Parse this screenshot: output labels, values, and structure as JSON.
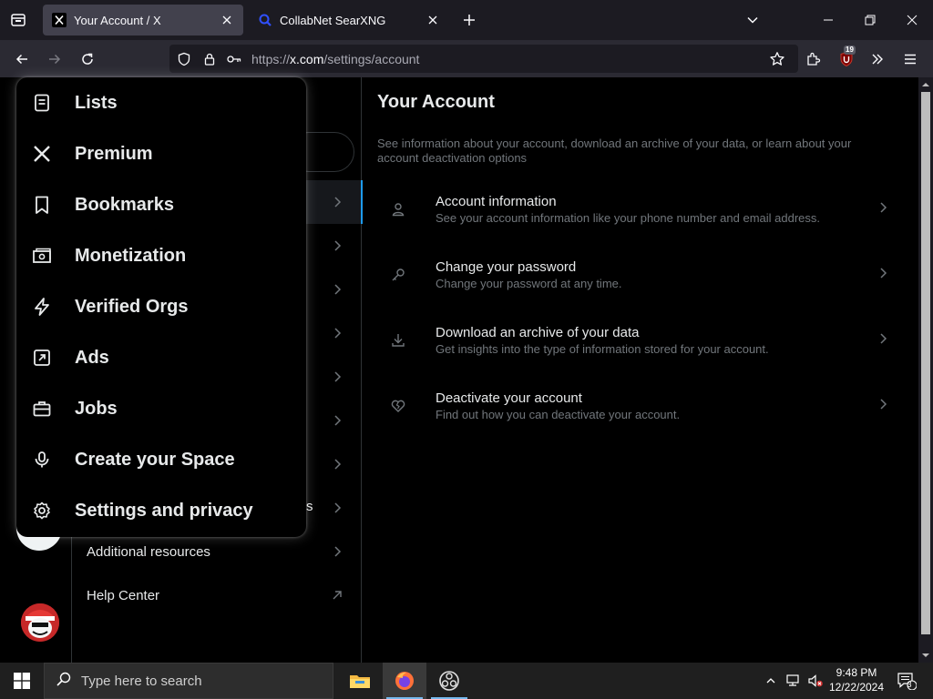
{
  "browser": {
    "tabs": [
      {
        "title": "Your Account / X",
        "active": true
      },
      {
        "title": "CollabNet SearXNG",
        "active": false
      }
    ],
    "url": {
      "prefix": "https://",
      "host": "x.com",
      "path": "/settings/account"
    },
    "extension_badge": "19"
  },
  "more_menu": {
    "items": [
      {
        "label": "Lists",
        "icon": "list-icon"
      },
      {
        "label": "Premium",
        "icon": "x-logo-icon"
      },
      {
        "label": "Bookmarks",
        "icon": "bookmark-icon"
      },
      {
        "label": "Monetization",
        "icon": "money-icon"
      },
      {
        "label": "Verified Orgs",
        "icon": "lightning-icon"
      },
      {
        "label": "Ads",
        "icon": "external-arrow-icon"
      },
      {
        "label": "Jobs",
        "icon": "briefcase-icon"
      },
      {
        "label": "Create your Space",
        "icon": "microphone-icon"
      },
      {
        "label": "Settings and privacy",
        "icon": "gear-icon"
      }
    ]
  },
  "settings_nav": {
    "partial_label_fragment": "s",
    "items": [
      {
        "label": "Additional resources"
      },
      {
        "label": "Help Center"
      }
    ]
  },
  "main": {
    "title": "Your Account",
    "description": "See information about your account, download an archive of your data, or learn about your account deactivation options",
    "rows": [
      {
        "title": "Account information",
        "subtitle": "See your account information like your phone number and email address.",
        "icon": "person-icon"
      },
      {
        "title": "Change your password",
        "subtitle": "Change your password at any time.",
        "icon": "key-icon"
      },
      {
        "title": "Download an archive of your data",
        "subtitle": "Get insights into the type of information stored for your account.",
        "icon": "download-icon"
      },
      {
        "title": "Deactivate your account",
        "subtitle": "Find out how you can deactivate your account.",
        "icon": "broken-heart-icon"
      }
    ]
  },
  "taskbar": {
    "search_placeholder": "Type here to search",
    "time": "9:48 PM",
    "date": "12/22/2024",
    "notification_count": "3"
  },
  "colors": {
    "accent": "#1d9bf0",
    "background": "#000000",
    "text_primary": "#e7e9ea",
    "text_secondary": "#71767b",
    "border": "#2f3336"
  }
}
